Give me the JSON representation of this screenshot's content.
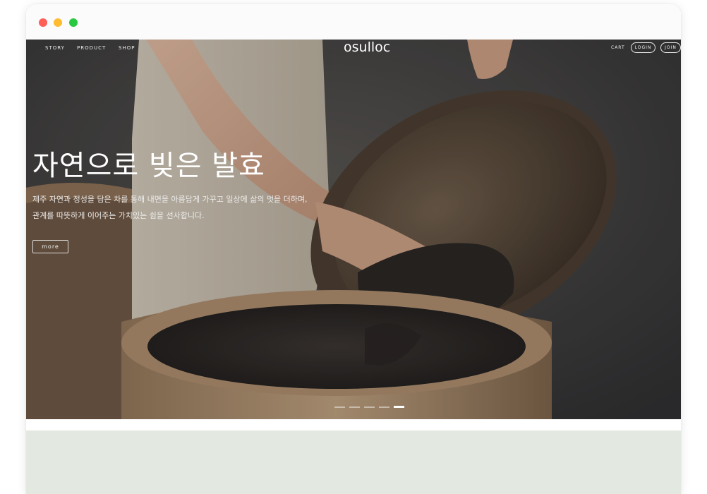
{
  "nav": {
    "items": [
      "STORY",
      "PRODUCT",
      "SHOP"
    ],
    "logo": "osulloc",
    "cart": "CART",
    "login": "LOGIN",
    "join": "JOIN"
  },
  "hero": {
    "headline": "자연으로 빚은 발효",
    "desc_line1": "제주 자연과 정성을 담은 차를 통해 내면을 아름답게 가꾸고 일상에 삶의 멋을 더하며,",
    "desc_line2": "관계를 따뜻하게 이어주는 가치있는 쉼을 선사합니다.",
    "more_label": "more",
    "slide_count": 5,
    "active_slide": 5
  },
  "colors": {
    "window_bg": "#fbfbfb",
    "section_green": "#e3e8e1",
    "traffic_red": "#ff5f57",
    "traffic_yellow": "#febc2e",
    "traffic_green": "#28c840"
  }
}
